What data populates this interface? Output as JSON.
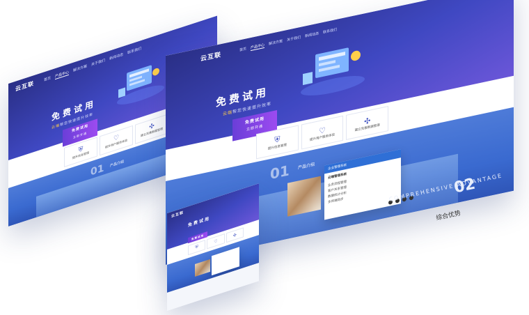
{
  "brand": {
    "logo_text": "云互联",
    "primary": "#3f48c2",
    "accent": "#ffcf4a",
    "trial_color": "#8a44e6"
  },
  "nav": {
    "items": [
      "首页",
      "产品中心",
      "解决方案",
      "关于我们",
      "新闻动态",
      "联系我们"
    ],
    "active_index": 1
  },
  "banner": {
    "title": "免费试用",
    "subtitle_prefix": "云端",
    "subtitle_rest": "帮您快速提升效率",
    "trial_button": "免费试用",
    "trial_subtext": "立即开通"
  },
  "features": [
    {
      "icon": "shield-check-icon",
      "label": "提升信息管理"
    },
    {
      "icon": "heart-icon",
      "label": "提升用户服务体验"
    },
    {
      "icon": "network-icon",
      "label": "建立完善数据管理"
    }
  ],
  "section_product": {
    "number": "01",
    "title": "产品介绍"
  },
  "product_card": {
    "header": "企业管理系统",
    "title": "云端管理系统",
    "items": [
      "业务流程管理",
      "客户关系管理",
      "数据统计分析",
      "多终端同步"
    ]
  },
  "section_advantage": {
    "number": "02",
    "watermark": "COMPREHENSIVE ADVANTAGE",
    "title": "综合优势"
  }
}
